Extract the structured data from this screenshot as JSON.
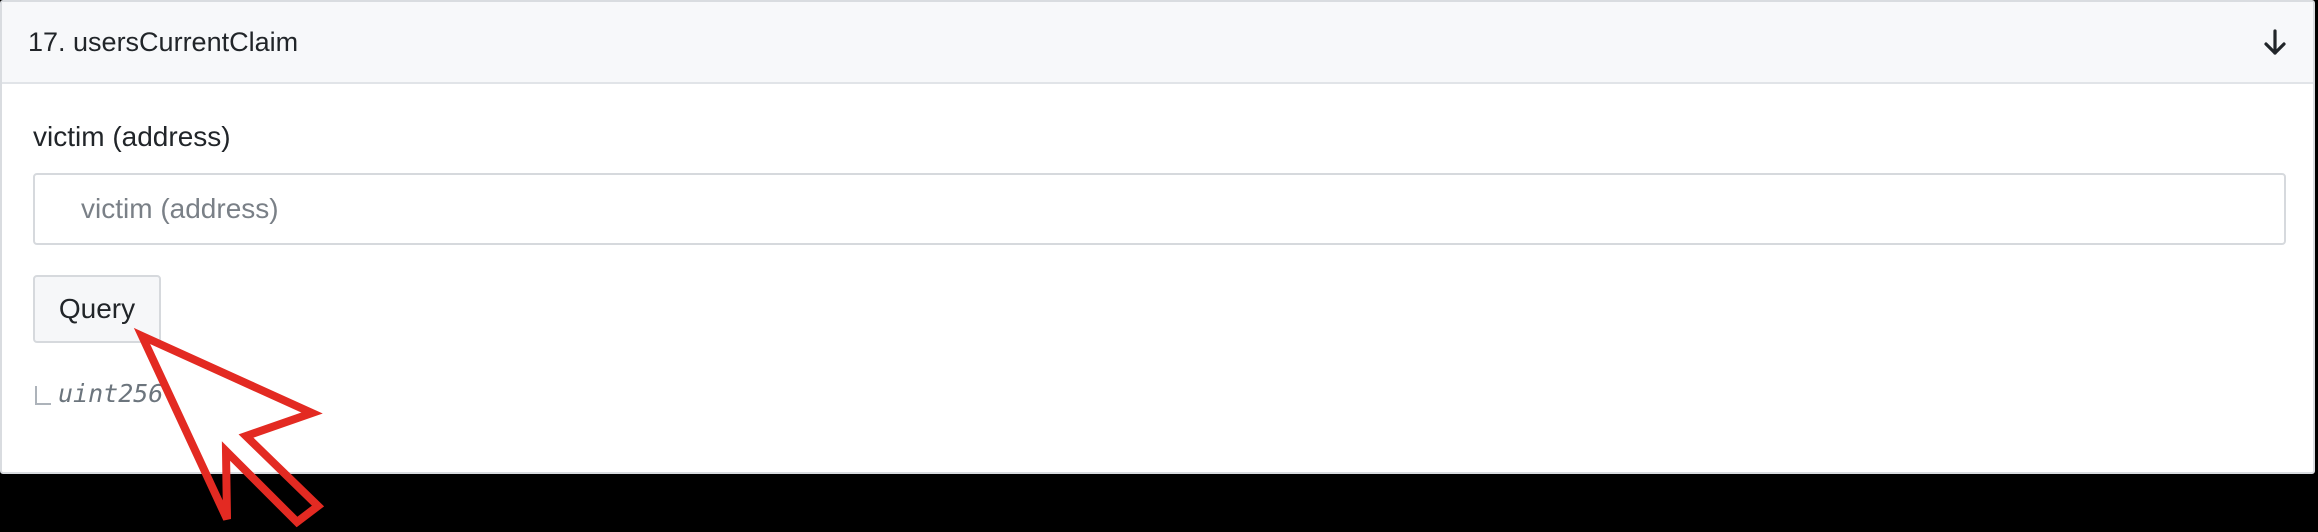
{
  "method": {
    "title": "17. usersCurrentClaim",
    "toggle_icon": "arrow-down-icon"
  },
  "input": {
    "label": "victim (address)",
    "placeholder": "victim (address)",
    "value": ""
  },
  "query_button": {
    "label": "Query"
  },
  "result": {
    "type": "uint256"
  },
  "annotation": {
    "icon": "pointer-arrow-icon",
    "color": "#e32a22"
  }
}
